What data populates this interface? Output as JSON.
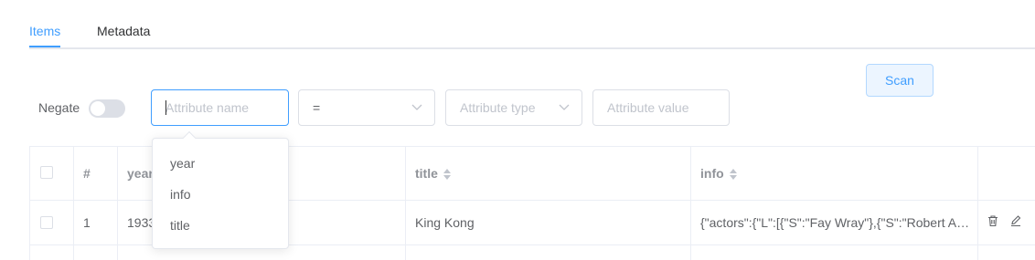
{
  "tabs": [
    {
      "label": "Items"
    },
    {
      "label": "Metadata"
    }
  ],
  "scan_button": {
    "label": "Scan"
  },
  "filter": {
    "negate_label": "Negate",
    "attribute_name_placeholder": "Attribute name",
    "operator_value": "=",
    "attribute_type_placeholder": "Attribute type",
    "attribute_value_placeholder": "Attribute value"
  },
  "attribute_dropdown": {
    "options": [
      "year",
      "info",
      "title"
    ]
  },
  "table": {
    "headers": {
      "index": "#",
      "year": "year",
      "title": "title",
      "info": "info"
    },
    "rows": [
      {
        "index": "1",
        "year": "1933",
        "title": "King Kong",
        "info": "{\"actors\":{\"L\":[{\"S\":\"Fay Wray\"},{\"S\":\"Robert Armstrong\"}]}}"
      }
    ]
  },
  "colors": {
    "accent": "#409eff",
    "border": "#dcdfe6",
    "muted_text": "#909399"
  },
  "icons": [
    "chevron-down-icon",
    "sort-icon",
    "trash-icon",
    "edit-icon"
  ]
}
